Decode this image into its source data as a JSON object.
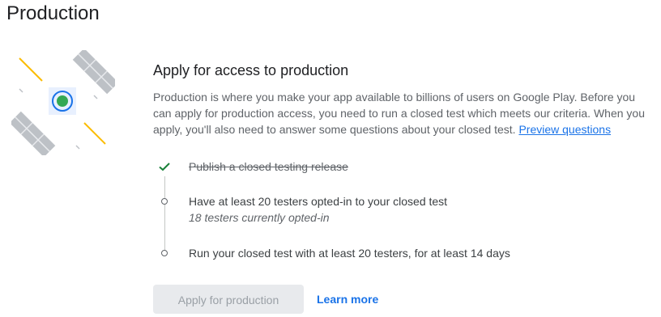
{
  "page": {
    "title": "Production"
  },
  "section": {
    "heading": "Apply for access to production",
    "description": "Production is where you make your app available to billions of users on Google Play. Before you can apply for production access, you need to run a closed test which meets our criteria. When you apply, you'll also need to answer some questions about your closed test.",
    "preview_link": "Preview questions"
  },
  "checklist": [
    {
      "text": "Publish a closed testing release",
      "status": "done",
      "icon": "check-icon"
    },
    {
      "text": "Have at least 20 testers opted-in to your closed test",
      "subtext": "18 testers currently opted-in",
      "status": "pending",
      "icon": "circle-outline-icon"
    },
    {
      "text": "Run your closed test with at least 20 testers, for at least 14 days",
      "status": "pending",
      "icon": "circle-outline-icon"
    }
  ],
  "actions": {
    "apply_label": "Apply for production",
    "learn_more_label": "Learn more"
  },
  "illustration": {
    "icon": "satellite-icon"
  },
  "colors": {
    "accent_blue": "#1a73e8",
    "check_green": "#188038",
    "satellite_green": "#34a853",
    "panel_gray": "#bdc1c6",
    "ray_yellow": "#fbbc04",
    "disabled_bg": "#e8eaed",
    "disabled_text": "#9aa0a6"
  }
}
